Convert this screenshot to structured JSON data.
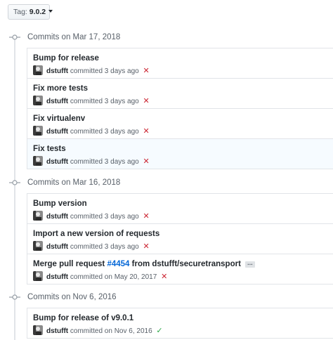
{
  "tag_selector": {
    "prefix": "Tag:",
    "value": "9.0.2"
  },
  "groups": [
    {
      "title": "Commits on Mar 17, 2018",
      "commits": [
        {
          "title": "Bump for release",
          "author": "dstufft",
          "action": "committed",
          "time": "3 days ago",
          "status": "failure"
        },
        {
          "title": "Fix more tests",
          "author": "dstufft",
          "action": "committed",
          "time": "3 days ago",
          "status": "failure"
        },
        {
          "title": "Fix virtualenv",
          "author": "dstufft",
          "action": "committed",
          "time": "3 days ago",
          "status": "failure"
        },
        {
          "title": "Fix tests",
          "author": "dstufft",
          "action": "committed",
          "time": "3 days ago",
          "status": "failure"
        }
      ]
    },
    {
      "title": "Commits on Mar 16, 2018",
      "commits": [
        {
          "title": "Bump version",
          "author": "dstufft",
          "action": "committed",
          "time": "3 days ago",
          "status": "failure"
        },
        {
          "title": "Import a new version of requests",
          "author": "dstufft",
          "action": "committed",
          "time": "3 days ago",
          "status": "failure"
        },
        {
          "title_prefix": "Merge pull request",
          "pr_link": "#4454",
          "title_suffix": "from dstufft/securetransport",
          "ellipsis": "…",
          "author": "dstufft",
          "action": "committed on",
          "time": "May 20, 2017",
          "status": "failure"
        }
      ]
    },
    {
      "title": "Commits on Nov 6, 2016",
      "commits": [
        {
          "title": "Bump for release of v9.0.1",
          "author": "dstufft",
          "action": "committed on",
          "time": "Nov 6, 2016",
          "status": "success"
        }
      ]
    }
  ],
  "status_glyphs": {
    "failure": "✕",
    "success": "✓"
  },
  "colors": {
    "failure": "#cb2431",
    "success": "#28a745",
    "link": "#0366d6"
  }
}
